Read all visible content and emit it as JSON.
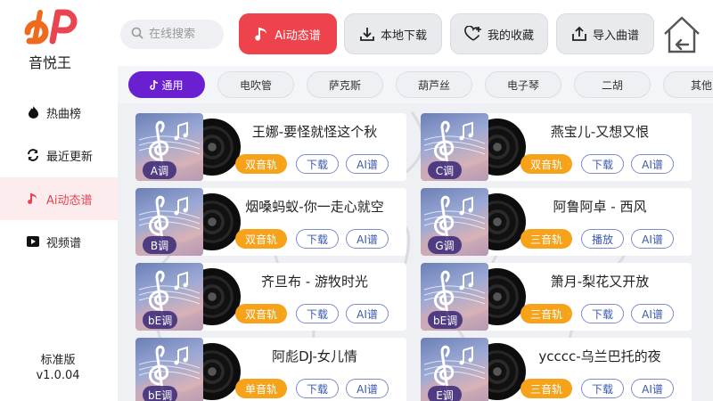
{
  "app": {
    "name": "音悦王",
    "edition": "标准版",
    "version": "v1.0.04"
  },
  "search": {
    "placeholder": "在线搜索"
  },
  "toolbar": {
    "ai_label": "Ai动态谱",
    "local_download": "本地下载",
    "favorites": "我的收藏",
    "import": "导入曲谱"
  },
  "sidebar": {
    "items": [
      {
        "label": "热曲榜",
        "icon": "flame-icon",
        "active": false
      },
      {
        "label": "最近更新",
        "icon": "refresh-icon",
        "active": false
      },
      {
        "label": "Ai动态谱",
        "icon": "music-note-icon",
        "active": true
      },
      {
        "label": "视频谱",
        "icon": "video-icon",
        "active": false
      }
    ]
  },
  "categories": [
    {
      "label": "通用",
      "active": true
    },
    {
      "label": "电吹管",
      "active": false
    },
    {
      "label": "萨克斯",
      "active": false
    },
    {
      "label": "葫芦丝",
      "active": false
    },
    {
      "label": "电子琴",
      "active": false
    },
    {
      "label": "二胡",
      "active": false
    },
    {
      "label": "其他",
      "active": false
    }
  ],
  "songs": [
    {
      "title": "王娜-要怪就怪这个秋",
      "key": "A调",
      "track": "双音轨",
      "action": "下载",
      "ai": "AI谱"
    },
    {
      "title": "燕宝儿-又想又恨",
      "key": "C调",
      "track": "双音轨",
      "action": "下载",
      "ai": "AI谱"
    },
    {
      "title": "烟嗓蚂蚁-你一走心就空",
      "key": "B调",
      "track": "双音轨",
      "action": "下载",
      "ai": "AI谱"
    },
    {
      "title": "阿鲁阿卓 - 西风",
      "key": "G调",
      "track": "三音轨",
      "action": "播放",
      "ai": "AI谱"
    },
    {
      "title": "齐旦布 - 游牧时光",
      "key": "bE调",
      "track": "双音轨",
      "action": "下载",
      "ai": "AI谱"
    },
    {
      "title": "箫月-梨花又开放",
      "key": "bE调",
      "track": "三音轨",
      "action": "下载",
      "ai": "AI谱"
    },
    {
      "title": "阿彪DJ-女儿情",
      "key": "bE调",
      "track": "单音轨",
      "action": "下载",
      "ai": "AI谱"
    },
    {
      "title": "yсссс-乌兰巴托的夜",
      "key": "E调",
      "track": "三音轨",
      "action": "下载",
      "ai": "AI谱"
    }
  ],
  "colors": {
    "accent": "#ee434c",
    "chip_active": "#6a1fd0",
    "track_tag": "#f7a21b",
    "outline_tag": "#3a58b0",
    "nav_active_bg": "#fdecee"
  }
}
